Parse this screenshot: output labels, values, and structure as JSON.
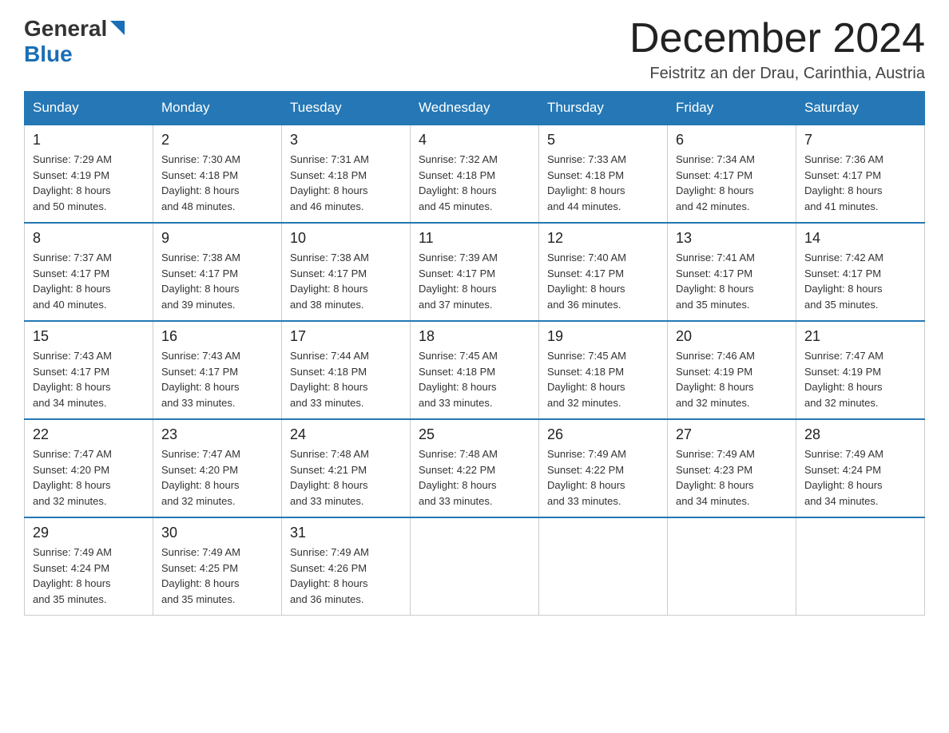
{
  "header": {
    "logo_general": "General",
    "logo_blue": "Blue",
    "title": "December 2024",
    "location": "Feistritz an der Drau, Carinthia, Austria"
  },
  "days_of_week": [
    "Sunday",
    "Monday",
    "Tuesday",
    "Wednesday",
    "Thursday",
    "Friday",
    "Saturday"
  ],
  "weeks": [
    [
      {
        "day": "1",
        "sunrise": "Sunrise: 7:29 AM",
        "sunset": "Sunset: 4:19 PM",
        "daylight": "Daylight: 8 hours",
        "daylight2": "and 50 minutes."
      },
      {
        "day": "2",
        "sunrise": "Sunrise: 7:30 AM",
        "sunset": "Sunset: 4:18 PM",
        "daylight": "Daylight: 8 hours",
        "daylight2": "and 48 minutes."
      },
      {
        "day": "3",
        "sunrise": "Sunrise: 7:31 AM",
        "sunset": "Sunset: 4:18 PM",
        "daylight": "Daylight: 8 hours",
        "daylight2": "and 46 minutes."
      },
      {
        "day": "4",
        "sunrise": "Sunrise: 7:32 AM",
        "sunset": "Sunset: 4:18 PM",
        "daylight": "Daylight: 8 hours",
        "daylight2": "and 45 minutes."
      },
      {
        "day": "5",
        "sunrise": "Sunrise: 7:33 AM",
        "sunset": "Sunset: 4:18 PM",
        "daylight": "Daylight: 8 hours",
        "daylight2": "and 44 minutes."
      },
      {
        "day": "6",
        "sunrise": "Sunrise: 7:34 AM",
        "sunset": "Sunset: 4:17 PM",
        "daylight": "Daylight: 8 hours",
        "daylight2": "and 42 minutes."
      },
      {
        "day": "7",
        "sunrise": "Sunrise: 7:36 AM",
        "sunset": "Sunset: 4:17 PM",
        "daylight": "Daylight: 8 hours",
        "daylight2": "and 41 minutes."
      }
    ],
    [
      {
        "day": "8",
        "sunrise": "Sunrise: 7:37 AM",
        "sunset": "Sunset: 4:17 PM",
        "daylight": "Daylight: 8 hours",
        "daylight2": "and 40 minutes."
      },
      {
        "day": "9",
        "sunrise": "Sunrise: 7:38 AM",
        "sunset": "Sunset: 4:17 PM",
        "daylight": "Daylight: 8 hours",
        "daylight2": "and 39 minutes."
      },
      {
        "day": "10",
        "sunrise": "Sunrise: 7:38 AM",
        "sunset": "Sunset: 4:17 PM",
        "daylight": "Daylight: 8 hours",
        "daylight2": "and 38 minutes."
      },
      {
        "day": "11",
        "sunrise": "Sunrise: 7:39 AM",
        "sunset": "Sunset: 4:17 PM",
        "daylight": "Daylight: 8 hours",
        "daylight2": "and 37 minutes."
      },
      {
        "day": "12",
        "sunrise": "Sunrise: 7:40 AM",
        "sunset": "Sunset: 4:17 PM",
        "daylight": "Daylight: 8 hours",
        "daylight2": "and 36 minutes."
      },
      {
        "day": "13",
        "sunrise": "Sunrise: 7:41 AM",
        "sunset": "Sunset: 4:17 PM",
        "daylight": "Daylight: 8 hours",
        "daylight2": "and 35 minutes."
      },
      {
        "day": "14",
        "sunrise": "Sunrise: 7:42 AM",
        "sunset": "Sunset: 4:17 PM",
        "daylight": "Daylight: 8 hours",
        "daylight2": "and 35 minutes."
      }
    ],
    [
      {
        "day": "15",
        "sunrise": "Sunrise: 7:43 AM",
        "sunset": "Sunset: 4:17 PM",
        "daylight": "Daylight: 8 hours",
        "daylight2": "and 34 minutes."
      },
      {
        "day": "16",
        "sunrise": "Sunrise: 7:43 AM",
        "sunset": "Sunset: 4:17 PM",
        "daylight": "Daylight: 8 hours",
        "daylight2": "and 33 minutes."
      },
      {
        "day": "17",
        "sunrise": "Sunrise: 7:44 AM",
        "sunset": "Sunset: 4:18 PM",
        "daylight": "Daylight: 8 hours",
        "daylight2": "and 33 minutes."
      },
      {
        "day": "18",
        "sunrise": "Sunrise: 7:45 AM",
        "sunset": "Sunset: 4:18 PM",
        "daylight": "Daylight: 8 hours",
        "daylight2": "and 33 minutes."
      },
      {
        "day": "19",
        "sunrise": "Sunrise: 7:45 AM",
        "sunset": "Sunset: 4:18 PM",
        "daylight": "Daylight: 8 hours",
        "daylight2": "and 32 minutes."
      },
      {
        "day": "20",
        "sunrise": "Sunrise: 7:46 AM",
        "sunset": "Sunset: 4:19 PM",
        "daylight": "Daylight: 8 hours",
        "daylight2": "and 32 minutes."
      },
      {
        "day": "21",
        "sunrise": "Sunrise: 7:47 AM",
        "sunset": "Sunset: 4:19 PM",
        "daylight": "Daylight: 8 hours",
        "daylight2": "and 32 minutes."
      }
    ],
    [
      {
        "day": "22",
        "sunrise": "Sunrise: 7:47 AM",
        "sunset": "Sunset: 4:20 PM",
        "daylight": "Daylight: 8 hours",
        "daylight2": "and 32 minutes."
      },
      {
        "day": "23",
        "sunrise": "Sunrise: 7:47 AM",
        "sunset": "Sunset: 4:20 PM",
        "daylight": "Daylight: 8 hours",
        "daylight2": "and 32 minutes."
      },
      {
        "day": "24",
        "sunrise": "Sunrise: 7:48 AM",
        "sunset": "Sunset: 4:21 PM",
        "daylight": "Daylight: 8 hours",
        "daylight2": "and 33 minutes."
      },
      {
        "day": "25",
        "sunrise": "Sunrise: 7:48 AM",
        "sunset": "Sunset: 4:22 PM",
        "daylight": "Daylight: 8 hours",
        "daylight2": "and 33 minutes."
      },
      {
        "day": "26",
        "sunrise": "Sunrise: 7:49 AM",
        "sunset": "Sunset: 4:22 PM",
        "daylight": "Daylight: 8 hours",
        "daylight2": "and 33 minutes."
      },
      {
        "day": "27",
        "sunrise": "Sunrise: 7:49 AM",
        "sunset": "Sunset: 4:23 PM",
        "daylight": "Daylight: 8 hours",
        "daylight2": "and 34 minutes."
      },
      {
        "day": "28",
        "sunrise": "Sunrise: 7:49 AM",
        "sunset": "Sunset: 4:24 PM",
        "daylight": "Daylight: 8 hours",
        "daylight2": "and 34 minutes."
      }
    ],
    [
      {
        "day": "29",
        "sunrise": "Sunrise: 7:49 AM",
        "sunset": "Sunset: 4:24 PM",
        "daylight": "Daylight: 8 hours",
        "daylight2": "and 35 minutes."
      },
      {
        "day": "30",
        "sunrise": "Sunrise: 7:49 AM",
        "sunset": "Sunset: 4:25 PM",
        "daylight": "Daylight: 8 hours",
        "daylight2": "and 35 minutes."
      },
      {
        "day": "31",
        "sunrise": "Sunrise: 7:49 AM",
        "sunset": "Sunset: 4:26 PM",
        "daylight": "Daylight: 8 hours",
        "daylight2": "and 36 minutes."
      },
      null,
      null,
      null,
      null
    ]
  ]
}
